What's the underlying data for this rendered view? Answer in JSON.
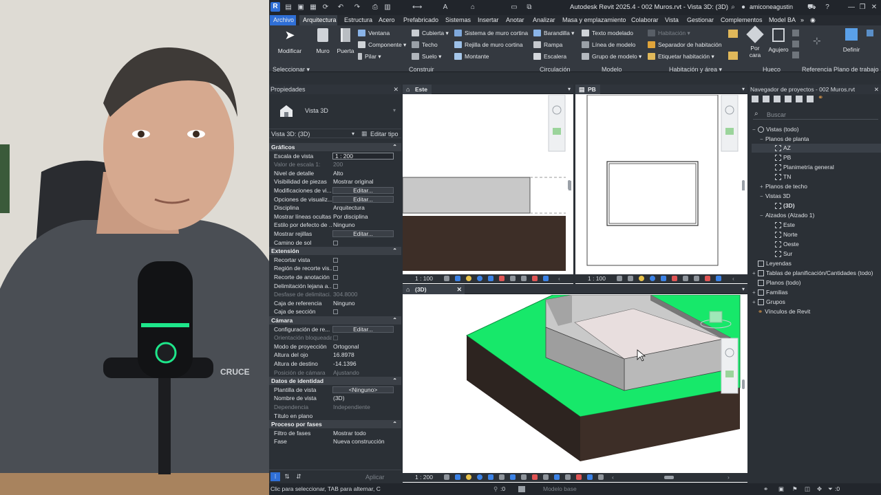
{
  "title": "Autodesk Revit 2025.4 - 002 Muros.rvt - Vista 3D: (3D)",
  "user": "amiconeagustin",
  "menu": [
    "Archivo",
    "Arquitectura",
    "Estructura",
    "Acero",
    "Prefabricado",
    "Sistemas",
    "Insertar",
    "Anotar",
    "Analizar",
    "Masa y emplazamiento",
    "Colaborar",
    "Vista",
    "Gestionar",
    "Complementos",
    "Model BA"
  ],
  "ribbon": {
    "modificar": "Modificar",
    "muro": "Muro",
    "puerta": "Puerta",
    "ventana": "Ventana",
    "componente": "Componente",
    "pilar": "Pilar",
    "cubierta": "Cubierta",
    "techo": "Techo",
    "suelo": "Suelo",
    "sistema_muro_cortina": "Sistema de muro cortina",
    "rejilla_muro_cortina": "Rejilla de muro cortina",
    "montante": "Montante",
    "barandilla": "Barandilla",
    "rampa": "Rampa",
    "escalera": "Escalera",
    "texto_modelado": "Texto modelado",
    "linea_modelo": "Línea de modelo",
    "grupo_modelo": "Grupo de modelo",
    "habitacion": "Habitación",
    "separador_habitacion": "Separador de habitación",
    "etiquetar_habitacion": "Etiquetar habitación",
    "por_cara": "Por\ncara",
    "por": "Por",
    "cara": "cara",
    "agujero": "Agujero",
    "definir": "Definir",
    "sections": {
      "seleccionar": "Seleccionar",
      "construir": "Construir",
      "circulacion": "Circulación",
      "modelo": "Modelo",
      "habitacion_area": "Habitación y área",
      "hueco": "Hueco",
      "referencia": "Referencia",
      "plano_trabajo": "Plano de trabajo"
    }
  },
  "properties": {
    "title": "Propiedades",
    "type_name": "Vista 3D",
    "instance": "Vista 3D: (3D)",
    "edit_type": "Editar tipo",
    "apply": "Aplicar",
    "groups": {
      "graficos": "Gráficos",
      "extension": "Extensión",
      "camara": "Cámara",
      "identidad": "Datos de identidad",
      "fases": "Proceso por fases"
    },
    "rows": {
      "escala_vista": [
        "Escala de vista",
        "1 : 200"
      ],
      "valor_escala": [
        "Valor de escala    1:",
        "200"
      ],
      "nivel_detalle": [
        "Nivel de detalle",
        "Alto"
      ],
      "visibilidad_piezas": [
        "Visibilidad de piezas",
        "Mostrar original"
      ],
      "modificaciones": [
        "Modificaciones de vi...",
        "Editar..."
      ],
      "opciones_visual": [
        "Opciones de visualiz...",
        "Editar..."
      ],
      "disciplina": [
        "Disciplina",
        "Arquitectura"
      ],
      "lineas_ocultas": [
        "Mostrar líneas ocultas",
        "Por disciplina"
      ],
      "estilo_defecto": [
        "Estilo por defecto de ...",
        "Ninguno"
      ],
      "mostrar_rejillas": [
        "Mostrar rejillas",
        "Editar..."
      ],
      "camino_sol": [
        "Camino de sol",
        ""
      ],
      "recortar_vista": [
        "Recortar vista",
        ""
      ],
      "region_recorte": [
        "Región de recorte vis...",
        ""
      ],
      "recorte_anotacion": [
        "Recorte de anotación",
        ""
      ],
      "delimitacion_lejana": [
        "Delimitación lejana a...",
        ""
      ],
      "desfase_delimit": [
        "Desfase de delimitaci...",
        "304.8000"
      ],
      "caja_referencia": [
        "Caja de referencia",
        "Ninguno"
      ],
      "caja_seccion": [
        "Caja de sección",
        ""
      ],
      "config_render": [
        "Configuración de re...",
        "Editar..."
      ],
      "orientacion_bloq": [
        "Orientación bloqueada",
        ""
      ],
      "modo_proyeccion": [
        "Modo de proyección",
        "Ortogonal"
      ],
      "altura_ojo": [
        "Altura del ojo",
        "16.8978"
      ],
      "altura_destino": [
        "Altura de destino",
        "-14.1396"
      ],
      "posicion_camara": [
        "Posición de cámara",
        "Ajustando"
      ],
      "plantilla_vista": [
        "Plantilla de vista",
        "<Ninguno>"
      ],
      "nombre_vista": [
        "Nombre de vista",
        "(3D)"
      ],
      "dependencia": [
        "Dependencia",
        "Independiente"
      ],
      "titulo_plano": [
        "Título en plano",
        ""
      ],
      "filtro_fases": [
        "Filtro de fases",
        "Mostrar todo"
      ],
      "fase": [
        "Fase",
        "Nueva construcción"
      ]
    }
  },
  "views": {
    "este": {
      "tab": "Este",
      "scale": "1 : 100"
    },
    "pb": {
      "tab": "PB",
      "scale": "1 : 100"
    },
    "v3d": {
      "tab": "(3D)",
      "scale": "1 : 200"
    }
  },
  "browser": {
    "title": "Navegador de proyectos - 002 Muros.rvt",
    "search_placeholder": "Buscar",
    "nodes": {
      "vistas": "Vistas (todo)",
      "planos_planta": "Planos de planta",
      "az": "AZ",
      "pb": "PB",
      "planimetria": "Planimetría general",
      "tn": "TN",
      "planos_techo": "Planos de techo",
      "vistas3d": "Vistas 3D",
      "v3d": "(3D)",
      "alzados": "Alzados (Alzado 1)",
      "este": "Este",
      "norte": "Norte",
      "oeste": "Oeste",
      "sur": "Sur",
      "leyendas": "Leyendas",
      "tablas": "Tablas de planificación/Cantidades (todo)",
      "planos": "Planos (todo)",
      "familias": "Familias",
      "grupos": "Grupos",
      "vinculos": "Vínculos de Revit"
    }
  },
  "status": {
    "hint": "Clic para seleccionar, TAB para alternar, C",
    "zero1": ":0",
    "modelo_base": "Modelo base",
    "zero2": ":0"
  },
  "colors": {
    "accent": "#2f6fd6",
    "grass": "#17e86a",
    "soil": "#3d2e27",
    "wall": "#b9b9b9"
  },
  "webcam": {
    "mic_brand": "CRUCE"
  }
}
